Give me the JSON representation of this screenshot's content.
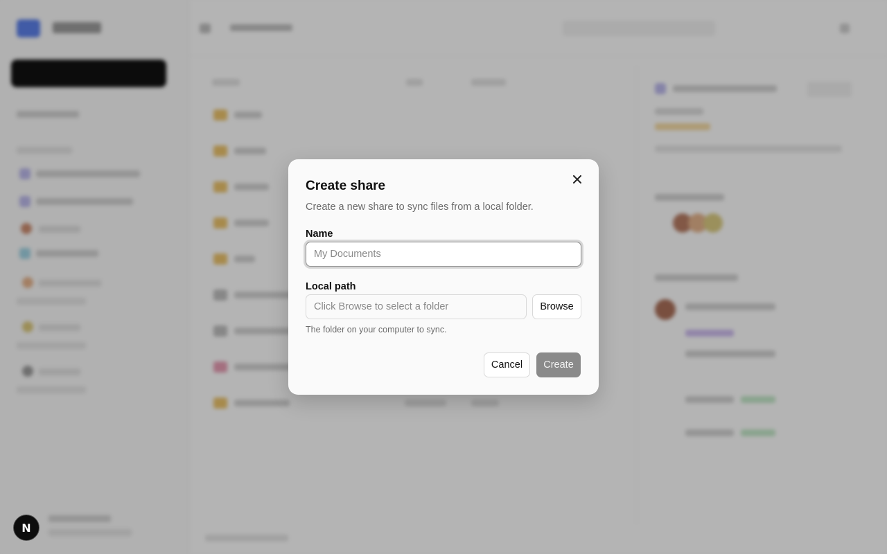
{
  "dialog": {
    "title": "Create share",
    "description": "Create a new share to sync files from a local folder.",
    "close_icon": "close-icon",
    "name": {
      "label": "Name",
      "value": "",
      "placeholder": "My Documents"
    },
    "local_path": {
      "label": "Local path",
      "value": "",
      "placeholder": "Click Browse to select a folder",
      "browse_label": "Browse",
      "hint": "The folder on your computer to sync."
    },
    "cancel_label": "Cancel",
    "create_label": "Create",
    "create_enabled": false
  },
  "badge": {
    "letter": "N"
  },
  "colors": {
    "overlay": "#00000047",
    "dialog_bg": "#fafafa",
    "create_disabled_bg": "#8a8a8a",
    "folder_icon": "#e8c06a",
    "logo_accent": "#5a7ee6"
  }
}
